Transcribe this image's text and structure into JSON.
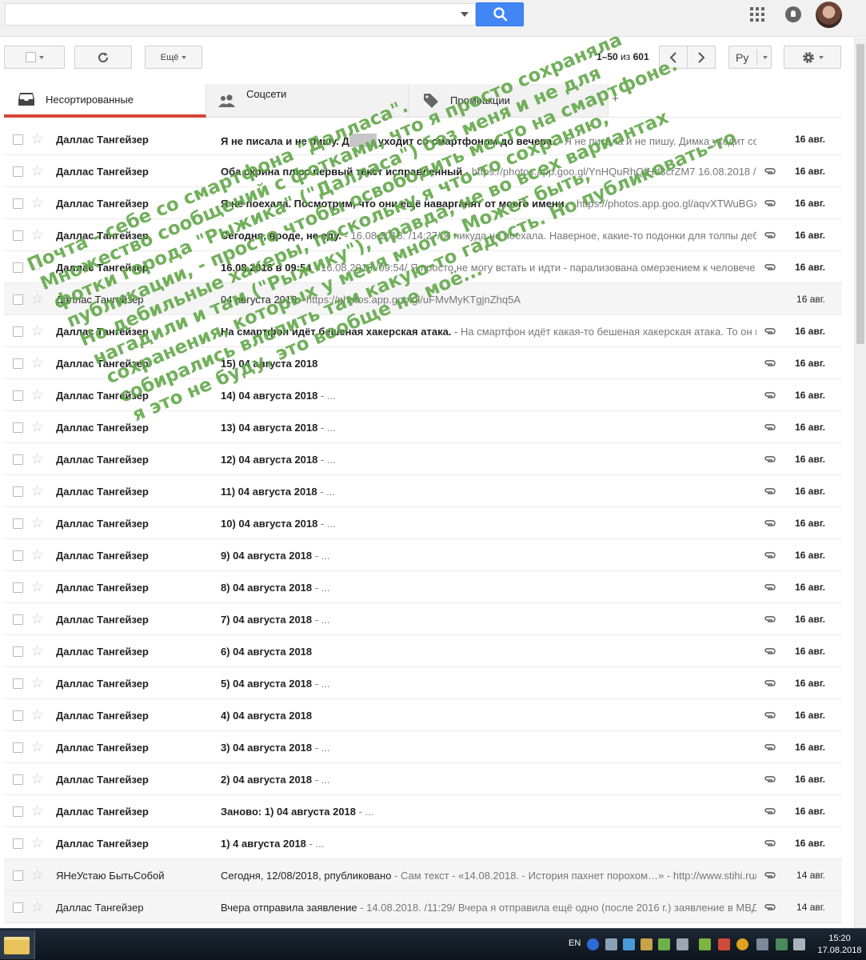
{
  "search": {
    "value": "",
    "placeholder": ""
  },
  "toolbar": {
    "more_label": "Ещё",
    "pager_range": "1–50",
    "pager_of": "из",
    "pager_total": "601",
    "lang_label": "Ру"
  },
  "tabs": [
    {
      "label": "Несортированные",
      "icon": "inbox-icon"
    },
    {
      "label": "Соцсети",
      "icon": "people-icon"
    },
    {
      "label": "Промоакции",
      "icon": "tag-icon"
    }
  ],
  "tab_add_label": "+",
  "messages": [
    {
      "sender": "Даллас Тангейзер",
      "subject": "Я не писала и не пишу. Д",
      "redacted": true,
      "subject_after": "уходит со смартфоном до вечера.",
      "snippet": " - Я не писала и не пишу. Димка уходит со с",
      "attachment": false,
      "date": "16 авг.",
      "unread": true
    },
    {
      "sender": "Даллас Тангейзер",
      "subject": "Оба скрина плюс первый текст исправленный",
      "snippet": " - https://photos.app.goo.gl/YnHQuRhQfHd3crZM7 16.08.2018 /09",
      "attachment": true,
      "date": "16 авг.",
      "unread": true
    },
    {
      "sender": "Даллас Тангейзер",
      "subject": "Я не поехала. Посмотрим, что они ещё наварганят от моего имени.",
      "snippet": " - https://photos.app.goo.gl/aqvXTWuBGxZ",
      "attachment": true,
      "date": "16 авг.",
      "unread": true
    },
    {
      "sender": "Даллас Тангейзер",
      "subject": "Сегодня, вроде, не еду.",
      "snippet": " - 16.08.2018. /14:27/ Я никуда не поехала. Наверное, какие-то подонки для толпы деби",
      "attachment": true,
      "date": "16 авг.",
      "unread": true
    },
    {
      "sender": "Даллас Тангейзер",
      "subject": "16.08.2018 в 09:54",
      "snippet": " - 16.08.2018 /09:54/ Я просто не могу встать и идти - парализована омерзением к человече",
      "attachment": true,
      "date": "16 авг.",
      "unread": true
    },
    {
      "sender": "Даллас Тангейзер",
      "subject": "04 августа 2018",
      "snippet": " - https://photos.app.goo.gl/uFMvMyKTgjnZhq5A",
      "attachment": false,
      "date": "16 авг.",
      "unread": false
    },
    {
      "sender": "Даллас Тангейзер",
      "subject": "На смартфон идёт бешеная хакерская атака.",
      "snippet": " - На смартфон идёт какая-то бешеная хакерская атака. То он во",
      "attachment": true,
      "date": "16 авг.",
      "unread": true
    },
    {
      "sender": "Даллас Тангейзер",
      "subject": "15) 04 августа 2018",
      "snippet": "",
      "attachment": true,
      "date": "16 авг.",
      "unread": true
    },
    {
      "sender": "Даллас Тангейзер",
      "subject": "14) 04 августа 2018",
      "snippet": " - ...",
      "attachment": true,
      "date": "16 авг.",
      "unread": true
    },
    {
      "sender": "Даллас Тангейзер",
      "subject": "13) 04 августа 2018",
      "snippet": " - ...",
      "attachment": true,
      "date": "16 авг.",
      "unread": true
    },
    {
      "sender": "Даллас Тангейзер",
      "subject": "12) 04 августа 2018",
      "snippet": " - ...",
      "attachment": true,
      "date": "16 авг.",
      "unread": true
    },
    {
      "sender": "Даллас Тангейзер",
      "subject": "11) 04 августа 2018",
      "snippet": " - ...",
      "attachment": true,
      "date": "16 авг.",
      "unread": true
    },
    {
      "sender": "Даллас Тангейзер",
      "subject": "10) 04 августа 2018",
      "snippet": " - ...",
      "attachment": true,
      "date": "16 авг.",
      "unread": true
    },
    {
      "sender": "Даллас Тангейзер",
      "subject": "9) 04 августа 2018",
      "snippet": " - ...",
      "attachment": true,
      "date": "16 авг.",
      "unread": true
    },
    {
      "sender": "Даллас Тангейзер",
      "subject": "8) 04 августа 2018",
      "snippet": " - ...",
      "attachment": true,
      "date": "16 авг.",
      "unread": true
    },
    {
      "sender": "Даллас Тангейзер",
      "subject": "7) 04 августа 2018",
      "snippet": " - ...",
      "attachment": true,
      "date": "16 авг.",
      "unread": true
    },
    {
      "sender": "Даллас Тангейзер",
      "subject": "6) 04 августа 2018",
      "snippet": "",
      "attachment": true,
      "date": "16 авг.",
      "unread": true
    },
    {
      "sender": "Даллас Тангейзер",
      "subject": "5) 04 августа 2018",
      "snippet": " - ...",
      "attachment": true,
      "date": "16 авг.",
      "unread": true
    },
    {
      "sender": "Даллас Тангейзер",
      "subject": "4) 04 августа 2018",
      "snippet": "",
      "attachment": true,
      "date": "16 авг.",
      "unread": true
    },
    {
      "sender": "Даллас Тангейзер",
      "subject": "3) 04 августа 2018",
      "snippet": " - ...",
      "attachment": true,
      "date": "16 авг.",
      "unread": true
    },
    {
      "sender": "Даллас Тангейзер",
      "subject": "2) 04 августа 2018",
      "snippet": " - ...",
      "attachment": true,
      "date": "16 авг.",
      "unread": true
    },
    {
      "sender": "Даллас Тангейзер",
      "subject": "Заново: 1) 04 августа 2018",
      "snippet": " - ...",
      "attachment": true,
      "date": "16 авг.",
      "unread": true
    },
    {
      "sender": "Даллас Тангейзер",
      "subject": "1) 4 августа 2018",
      "snippet": " - ...",
      "attachment": true,
      "date": "16 авг.",
      "unread": true
    },
    {
      "sender": "ЯНеУстаю БытьСобой",
      "subject": "Сегодня, 12/08/2018, рпубликовано",
      "snippet": " - Сам текст - «14.08.2018. - История пахнет порохом…» - http://www.stihi.ru/20",
      "attachment": true,
      "date": "14 авг.",
      "unread": false
    },
    {
      "sender": "Даллас Тангейзер",
      "subject": "Вчера отправила заявление",
      "snippet": " - 14.08.2018. /11:29/ Вчера я отправила ещё одно (после 2016 г.) заявление в МВД с",
      "attachment": true,
      "date": "14 авг.",
      "unread": false
    }
  ],
  "overlay_lines": [
    "Почта - себе со смартфона \"Далласа\".",
    "Множество сообщений с фотками, что я просто сохраняла",
    "фотки города \"Рыжика\" (\"Далласа\") без меня и не для",
    "публикации, - просто чтобы освободить место на смартфоне.",
    "Но дебильные хакеры, поскольку я что-то сохраняю,",
    "нагадили и там (\"Рыжику\"), правда, не во всех вариантах",
    "сохранения, которых у меня много. Может быть,",
    "собирались влепить там какую-то гадость. Но публиковать-то",
    "я это не буду, это вообще не моё..."
  ],
  "taskbar": {
    "lang": "EN",
    "time": "15:20",
    "date": "17.08.2018"
  },
  "colors": {
    "accent_blue": "#4285f4",
    "tab_active": "#d44638",
    "overlay_green": "#5fa546"
  }
}
